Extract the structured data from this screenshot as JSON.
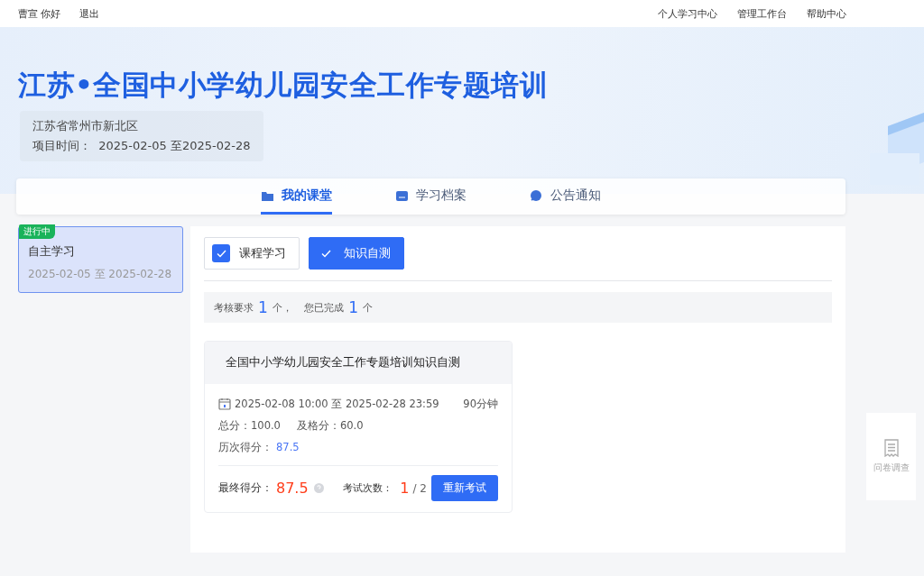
{
  "top_bar": {
    "greeting": "曹宣 你好",
    "logout": "退出",
    "links": [
      "个人学习中心",
      "管理工作台",
      "帮助中心"
    ]
  },
  "banner": {
    "title": "江苏•全国中小学幼儿园安全工作专题培训",
    "region": "江苏省常州市新北区",
    "period_label": "项目时间：",
    "period": "2025-02-05 至2025-02-28"
  },
  "nav_tabs": [
    {
      "label": "我的课堂",
      "selected": true
    },
    {
      "label": "学习档案",
      "selected": false
    },
    {
      "label": "公告通知",
      "selected": false
    }
  ],
  "stages": [
    {
      "badge": "进行中",
      "name": "自主学习",
      "dates": "2025-02-05 至 2025-02-28",
      "selected": true
    }
  ],
  "modules": [
    {
      "label": "课程学习",
      "selected": false
    },
    {
      "label": "知识自测",
      "selected": true
    }
  ],
  "summary": {
    "required_label": "考核要求",
    "required": "1",
    "unit_1": "个，",
    "done_label": "您已完成",
    "done": "1",
    "unit_2": "个"
  },
  "exam": {
    "title": "全国中小学幼儿园安全工作专题培训知识自测",
    "time_range": "2025-02-08 10:00 至 2025-02-28 23:59",
    "duration": "90分钟",
    "total": "总分：100.0",
    "pass": "及格分：60.0",
    "history_label": "历次得分：",
    "history": "87.5",
    "final_label": "最终得分：",
    "final": "87.5",
    "attempts_label": "考试次数：",
    "attempts_used": "1",
    "attempts_total": "/ 2",
    "retake": "重新考试"
  },
  "survey": {
    "label": "问卷调查"
  }
}
